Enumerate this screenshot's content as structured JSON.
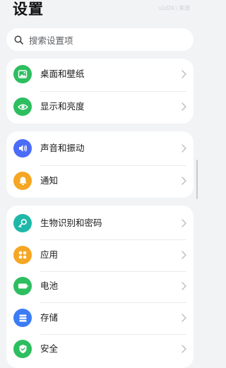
{
  "header": {
    "title": "设置",
    "watermark": "x1d24 | 来源"
  },
  "search": {
    "placeholder": "搜索设置项"
  },
  "groups": [
    {
      "items": [
        {
          "label": "桌面和壁纸",
          "icon": "wallpaper-icon",
          "color": "#2dbe60"
        },
        {
          "label": "显示和亮度",
          "icon": "eye-icon",
          "color": "#2dbe60"
        }
      ]
    },
    {
      "items": [
        {
          "label": "声音和振动",
          "icon": "speaker-icon",
          "color": "#4a6cf7"
        },
        {
          "label": "通知",
          "icon": "bell-icon",
          "color": "#f5a623"
        }
      ]
    },
    {
      "items": [
        {
          "label": "生物识别和密码",
          "icon": "key-icon",
          "color": "#1fb8a8"
        },
        {
          "label": "应用",
          "icon": "apps-grid-icon",
          "color": "#f5a623"
        },
        {
          "label": "电池",
          "icon": "battery-icon",
          "color": "#2dbe60"
        },
        {
          "label": "存储",
          "icon": "storage-icon",
          "color": "#3b7cf5"
        },
        {
          "label": "安全",
          "icon": "shield-icon",
          "color": "#2dbe60"
        }
      ]
    }
  ]
}
